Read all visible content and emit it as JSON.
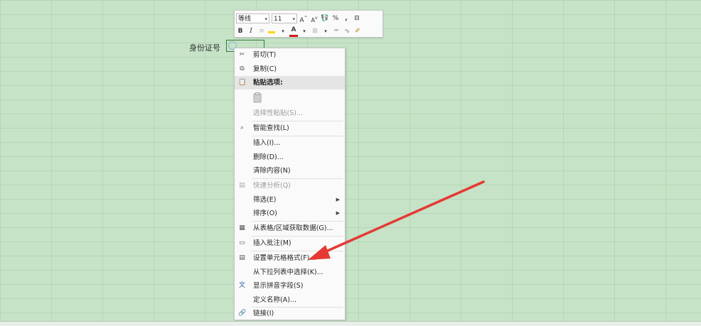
{
  "sheet": {
    "label": "身份证号"
  },
  "minitoolbar": {
    "font_name": "等线",
    "font_size": "11",
    "increase_font": "A",
    "decrease_font": "A",
    "percent": "%",
    "comma": ",",
    "bold": "B",
    "italic": "I",
    "font_color_letter": "A",
    "fill_color": "#ffd400",
    "font_color": "#d11d1d"
  },
  "context_menu": {
    "items": [
      {
        "label": "剪切(T)",
        "icon": "scissors-icon"
      },
      {
        "label": "复制(C)",
        "icon": "copy-icon"
      },
      {
        "label": "粘贴选项:",
        "icon": "paste-icon"
      },
      {
        "label": "选择性粘贴(S)...",
        "icon": ""
      },
      {
        "label": "智能查找(L)",
        "icon": "search-icon"
      },
      {
        "label": "插入(I)...",
        "icon": ""
      },
      {
        "label": "删除(D)...",
        "icon": ""
      },
      {
        "label": "清除内容(N)",
        "icon": ""
      },
      {
        "label": "快速分析(Q)",
        "icon": "quick-analysis-icon"
      },
      {
        "label": "筛选(E)",
        "icon": ""
      },
      {
        "label": "排序(O)",
        "icon": ""
      },
      {
        "label": "从表格/区域获取数据(G)...",
        "icon": "table-icon"
      },
      {
        "label": "插入批注(M)",
        "icon": "comment-icon"
      },
      {
        "label": "设置单元格格式(F)...",
        "icon": "format-cells-icon"
      },
      {
        "label": "从下拉列表中选择(K)...",
        "icon": ""
      },
      {
        "label": "显示拼音字段(S)",
        "icon": "phonetic-icon"
      },
      {
        "label": "定义名称(A)...",
        "icon": ""
      },
      {
        "label": "链接(I)",
        "icon": "link-icon"
      }
    ]
  },
  "annotation": {
    "arrow_color": "#e53935"
  }
}
